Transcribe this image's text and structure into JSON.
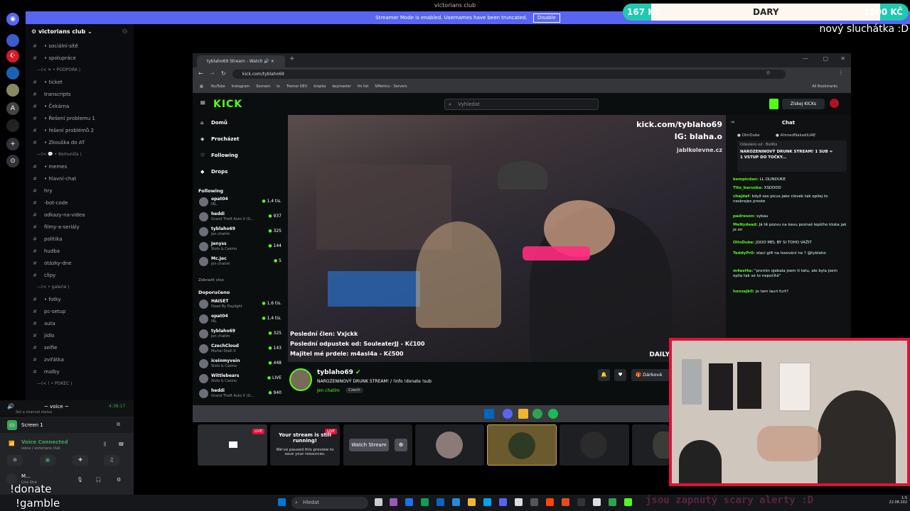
{
  "screen": {
    "window_title": "victorians club"
  },
  "banner": {
    "text": "Streamer Mode is enabled. Usernames have been truncated.",
    "disable_label": "Disable"
  },
  "overlay": {
    "left_amount": "167 KČ",
    "center": "DARY",
    "right_amount": "1500 KČ",
    "headphones_text": "nový sluchátka :D"
  },
  "discord": {
    "server_name": "victorians club",
    "channels": [
      {
        "icon": "#",
        "label": "• sociální-sítě",
        "kind": "text"
      },
      {
        "icon": "#",
        "label": "• spolupráce",
        "kind": "text"
      },
      {
        "icon": "",
        "label": "—(< ✕ • PODPORA ⟩",
        "kind": "category"
      },
      {
        "icon": "#",
        "label": "• ticket",
        "kind": "text"
      },
      {
        "icon": "#",
        "label": "transcripts",
        "kind": "text"
      },
      {
        "icon": "#",
        "label": "• Čekárna",
        "kind": "voice"
      },
      {
        "icon": "#",
        "label": "• Řešení problemu 1",
        "kind": "voice"
      },
      {
        "icon": "#",
        "label": "• řešení problémů 2",
        "kind": "voice"
      },
      {
        "icon": "#",
        "label": "• Zkouška do AT",
        "kind": "voice"
      },
      {
        "icon": "",
        "label": "—(< 💬 • Komunita ⟩",
        "kind": "category"
      },
      {
        "icon": "#",
        "label": "• memes",
        "kind": "text"
      },
      {
        "icon": "#",
        "label": "• hlavní-chat",
        "kind": "text"
      },
      {
        "icon": "#",
        "label": "hry",
        "kind": "text"
      },
      {
        "icon": "#",
        "label": "-bot-code",
        "kind": "text"
      },
      {
        "icon": "#",
        "label": "odkazy-na-videa",
        "kind": "text"
      },
      {
        "icon": "#",
        "label": "filmy-a-seriály",
        "kind": "text"
      },
      {
        "icon": "#",
        "label": "politika",
        "kind": "text"
      },
      {
        "icon": "#",
        "label": "hudba",
        "kind": "text"
      },
      {
        "icon": "#",
        "label": "otázky-dne",
        "kind": "text"
      },
      {
        "icon": "#",
        "label": "clipy",
        "kind": "text"
      },
      {
        "icon": "",
        "label": "—(< • galerie ⟩",
        "kind": "category"
      },
      {
        "icon": "#",
        "label": "• fotky",
        "kind": "text"
      },
      {
        "icon": "#",
        "label": "pc-setup",
        "kind": "text"
      },
      {
        "icon": "#",
        "label": "auta",
        "kind": "text"
      },
      {
        "icon": "#",
        "label": "jídlo",
        "kind": "text"
      },
      {
        "icon": "#",
        "label": "selfie",
        "kind": "text"
      },
      {
        "icon": "#",
        "label": "zvířátka",
        "kind": "text"
      },
      {
        "icon": "#",
        "label": "malby",
        "kind": "text"
      },
      {
        "icon": "",
        "label": "—(< ! • POKEC ⟩",
        "kind": "category"
      }
    ],
    "voice_channel": "voice",
    "voice_time": "4:38:17",
    "set_status": "Set a channel status",
    "screen_label": "Screen 1",
    "voice_connected": "Voice Connected",
    "voice_path": "voice / victorians club",
    "user_name": "M...",
    "user_status": "Live Stré"
  },
  "browser": {
    "tab_title": "tyblaho69 Stream - Watch",
    "url": "kick.com/tyblaho69",
    "bookmarks": [
      "YouTube",
      "Instagram",
      "Seznam",
      "tx",
      "Tremor DEV",
      "kropka",
      "keymaster",
      "fm list",
      "SMetrics - Servers"
    ],
    "all_bookmarks": "All Bookmarks"
  },
  "kick": {
    "logo": "KICK",
    "search_placeholder": "Vyhledat",
    "get_kicks": "Získej KICKs",
    "nav": [
      "Domů",
      "Procházet",
      "Following",
      "Drops"
    ],
    "following_heading": "Following",
    "following": [
      {
        "name": "opat04",
        "game": "IRL",
        "viewers": "1,4 tis."
      },
      {
        "name": "heddi",
        "game": "Grand Theft Auto V (G...",
        "viewers": "937"
      },
      {
        "name": "tyblaho69",
        "game": "Jen chatím",
        "viewers": "325"
      },
      {
        "name": "Jenyss",
        "game": "Slots & Casino",
        "viewers": "144"
      },
      {
        "name": "Mc.Jec",
        "game": "Jen chatím",
        "viewers": "5"
      }
    ],
    "show_more": "Zobrazit více",
    "recommended_heading": "Doporučeno",
    "recommended": [
      {
        "name": "HAISET",
        "game": "Dead By Daylight",
        "viewers": "1,6 tis."
      },
      {
        "name": "opat04",
        "game": "IRL",
        "viewers": "1,4 tis."
      },
      {
        "name": "tyblaho69",
        "game": "Jen chatím",
        "viewers": "325"
      },
      {
        "name": "CzechCloud",
        "game": "Mortal Shell II",
        "viewers": "143"
      },
      {
        "name": "iceinmyvein",
        "game": "Slots & Casino",
        "viewers": "448"
      },
      {
        "name": "Wittlebears",
        "game": "Slots & Casino",
        "viewers": "LIVE"
      },
      {
        "name": "heddi",
        "game": "Grand Theft Auto V (G...",
        "viewers": "940"
      }
    ],
    "video_overlay": {
      "url": "kick.com/tyblaho69",
      "ig": "IG: blaha.o",
      "sponsor": "jablkolevne.cz",
      "last_member": "Poslední člen: Vxjckk",
      "last_indulgence": "Poslední odpustek od: SouleaterJJ - Kč100",
      "owner": "Majitel mé prdele: m4asl4a - Kč500",
      "daily": "DAILY"
    },
    "channel": {
      "name": "tyblaho69",
      "title": "NAROZENINOVÝ DRUNK STREAM! / !info !donate !sub",
      "category": "Jen chatím",
      "tag": "Czech",
      "gift_button": "Dárkové"
    },
    "chat": {
      "title": "Chat",
      "pinned_users": [
        "OlinDuke",
        "AhmedNakadiUAE"
      ],
      "pinned_meta": "Odesláno od · BotRix",
      "pinned_text": "NAROZENINOVÝ DRUNK STREAM! 1 SUB = 1 VSTUP DO TOČKY...",
      "messages": [
        {
          "user": "kempicdan:",
          "text": "LL OLINDUKE"
        },
        {
          "user": "Tito_baruska:",
          "text": "XSDDDD"
        },
        {
          "user": "chajdaf:",
          "text": "když ses picus jako clovek tak opilej to neskrejes proste"
        },
        {
          "user": "padreson:",
          "text": "sybau"
        },
        {
          "user": "MeNydead:",
          "text": "Já tě pozvu na kavu poznaš lepšího kluka jak je on"
        },
        {
          "user": "OlinDuke:",
          "text": "JOOO MEL BY SI TOHO VAŽIT"
        },
        {
          "user": "TeddyPr0:",
          "text": "staci gift na losování ne ? @tyblaho"
        },
        {
          "user": "m4asl4a:",
          "text": "\"promin ojebala jsem ti tatu, ale byla jsem opila tak se to nepočítá\""
        },
        {
          "user": "honzajk0:",
          "text": "je tam lauri furt?"
        }
      ]
    }
  },
  "share_tray": {
    "live_badge": "LIVE",
    "running_title": "Your stream is still running!",
    "running_sub": "We've paused this preview to save your resources.",
    "watch_stream": "Watch Stream"
  },
  "chat_commands": {
    "donate": "!donate",
    "gamble": "!gamble"
  },
  "ticker": "jsou zapnutý scary alerty :D",
  "taskbar": {
    "search_placeholder": "Hledat",
    "time": "1:5",
    "date": "22.08.202"
  },
  "colors": {
    "kick_green": "#53fc18",
    "discord_blurple": "#5865f2",
    "cam_border": "#e0103a"
  }
}
